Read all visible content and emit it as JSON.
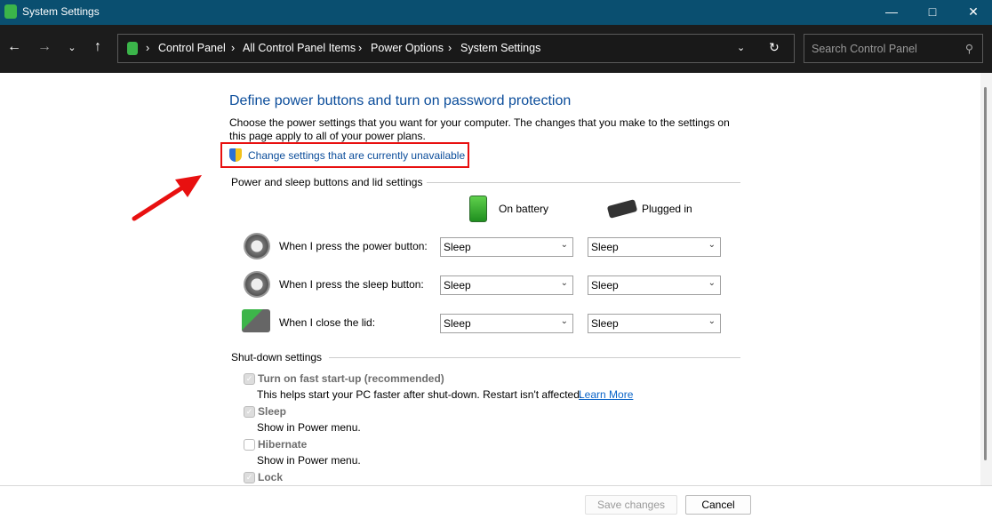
{
  "window": {
    "title": "System Settings",
    "icon": "power-options-icon"
  },
  "nav": {
    "breadcrumb": [
      "Control Panel",
      "All Control Panel Items",
      "Power Options",
      "System Settings"
    ],
    "search_placeholder": "Search Control Panel"
  },
  "main": {
    "title": "Define power buttons and turn on password protection",
    "description": "Choose the power settings that you want for your computer. The changes that you make to the settings on this page apply to all of your power plans.",
    "change_link": "Change settings that are currently unavailable",
    "buttons_section": "Power and sleep buttons and lid settings",
    "columns": [
      "On battery",
      "Plugged in"
    ],
    "rows": [
      {
        "label": "When I press the power button:",
        "battery": "Sleep",
        "plugged": "Sleep",
        "icon": "power-button-icon"
      },
      {
        "label": "When I press the sleep button:",
        "battery": "Sleep",
        "plugged": "Sleep",
        "icon": "sleep-button-icon"
      },
      {
        "label": "When I close the lid:",
        "battery": "Sleep",
        "plugged": "Sleep",
        "icon": "laptop-lid-icon"
      }
    ],
    "shutdown_section": "Shut-down settings",
    "options": [
      {
        "label": "Turn on fast start-up (recommended)",
        "desc": "This helps start your PC faster after shut-down. Restart isn't affected.",
        "link": "Learn More",
        "checked": true
      },
      {
        "label": "Sleep",
        "desc": "Show in Power menu.",
        "checked": true
      },
      {
        "label": "Hibernate",
        "desc": "Show in Power menu.",
        "checked": false
      },
      {
        "label": "Lock",
        "checked": true
      }
    ]
  },
  "footer": {
    "save": "Save changes",
    "cancel": "Cancel"
  },
  "colors": {
    "titlebar": "#0a4f70",
    "link": "#0a4c9a",
    "highlight": "#e81010"
  }
}
